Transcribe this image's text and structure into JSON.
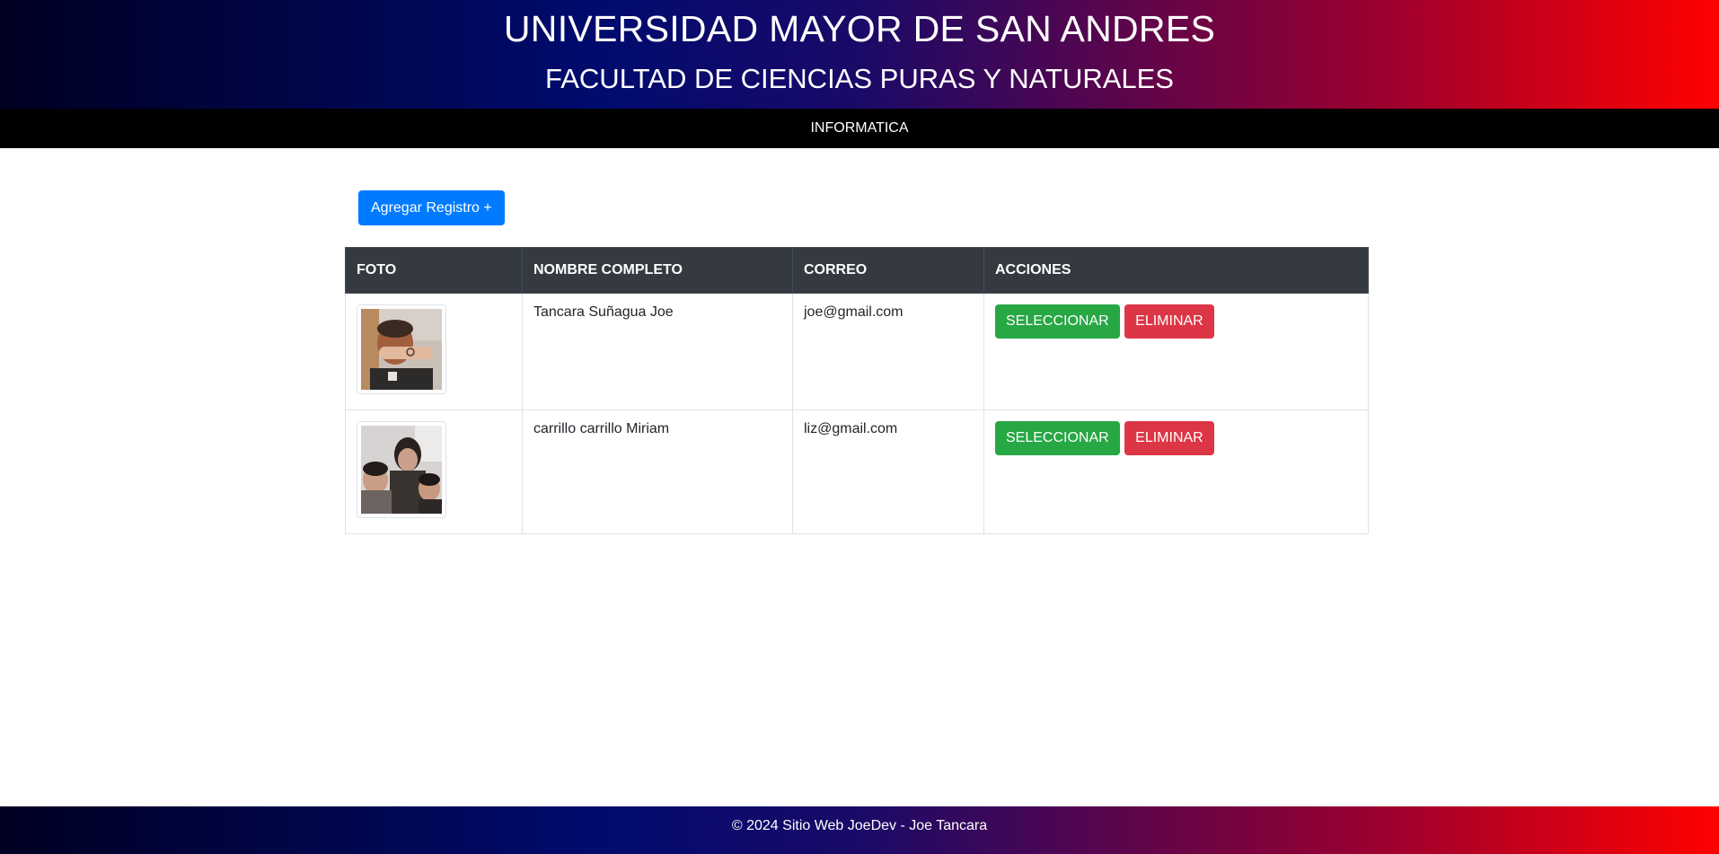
{
  "header": {
    "title": "UNIVERSIDAD MAYOR DE SAN ANDRES",
    "subtitle": "FACULTAD DE CIENCIAS PURAS Y NATURALES"
  },
  "nav": {
    "label": "INFORMATICA"
  },
  "toolbar": {
    "add_label": "Agregar Registro +"
  },
  "table": {
    "headers": [
      "FOTO",
      "NOMBRE COMPLETO",
      "CORREO",
      "ACCIONES"
    ],
    "rows": [
      {
        "name": "Tancara Suñagua Joe",
        "email": "joe@gmail.com",
        "select_label": "SELECCIONAR",
        "delete_label": "ELIMINAR"
      },
      {
        "name": "carrillo carrillo Miriam",
        "email": "liz@gmail.com",
        "select_label": "SELECCIONAR",
        "delete_label": "ELIMINAR"
      }
    ]
  },
  "colors": {
    "primary": "#007bff",
    "success": "#28a745",
    "danger": "#dc3545",
    "table_head": "#343a40"
  },
  "footer": {
    "text": "© 2024 Sitio Web JoeDev - Joe Tancara"
  }
}
